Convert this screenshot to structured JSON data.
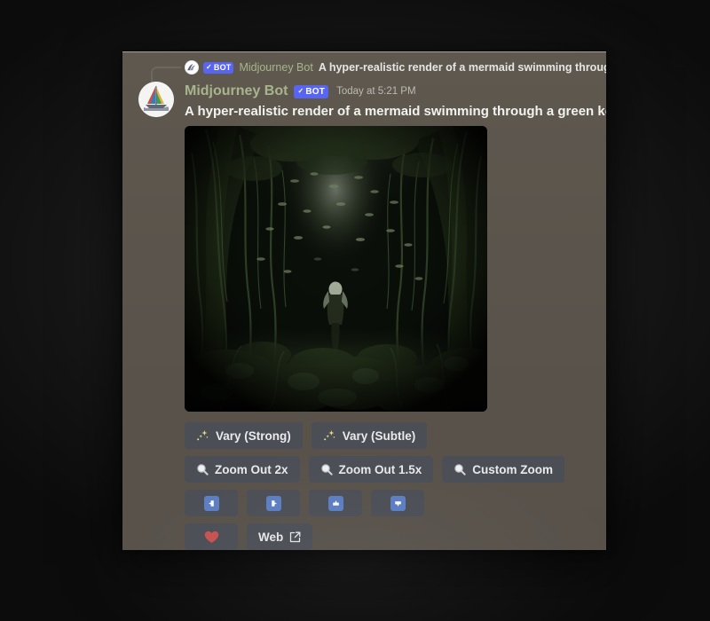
{
  "reply": {
    "avatar_icon": "midjourney-logo-icon",
    "badge_check": "✓",
    "badge_label": "BOT",
    "author": "Midjourney Bot",
    "text": "A hyper-realistic render of a mermaid swimming through"
  },
  "message": {
    "avatar_icon": "midjourney-sailboat-avatar",
    "author": "Midjourney Bot",
    "badge_check": "✓",
    "badge_label": "BOT",
    "timestamp": "Today at 5:21 PM",
    "body": "A hyper-realistic render of a mermaid swimming through a green kelp fo",
    "attachment": {
      "alt": "Underwater green kelp forest tunnel with a distant figure and light shafts",
      "dominant_color": "#2e3a24"
    }
  },
  "actions": {
    "rows": [
      [
        {
          "id": "vary-strong",
          "icon": "sparkles-icon",
          "label": "Vary (Strong)"
        },
        {
          "id": "vary-subtle",
          "icon": "sparkles-icon",
          "label": "Vary (Subtle)"
        }
      ],
      [
        {
          "id": "zoom-out-2x",
          "icon": "magnifying-glass-icon",
          "label": "Zoom Out 2x"
        },
        {
          "id": "zoom-out-1-5x",
          "icon": "magnifying-glass-icon",
          "label": "Zoom Out 1.5x"
        },
        {
          "id": "custom-zoom",
          "icon": "magnifying-glass-icon",
          "label": "Custom Zoom"
        }
      ],
      [
        {
          "id": "pan-left",
          "icon": "arrow-left-icon",
          "label": ""
        },
        {
          "id": "pan-right",
          "icon": "arrow-right-icon",
          "label": ""
        },
        {
          "id": "pan-up",
          "icon": "arrow-up-icon",
          "label": ""
        },
        {
          "id": "pan-down",
          "icon": "arrow-down-icon",
          "label": ""
        }
      ],
      [
        {
          "id": "favorite",
          "icon": "heart-icon",
          "label": ""
        },
        {
          "id": "web",
          "icon": "external-link-icon",
          "label": "Web"
        }
      ]
    ]
  },
  "colors": {
    "brand_blurple": "#5865f2",
    "bot_name_green": "#a8b58c",
    "button_bg": "#4b4e55",
    "panel_bg": "#59534b",
    "arrow_blue": "#5c7fc4",
    "heart_red": "#c9514f"
  }
}
